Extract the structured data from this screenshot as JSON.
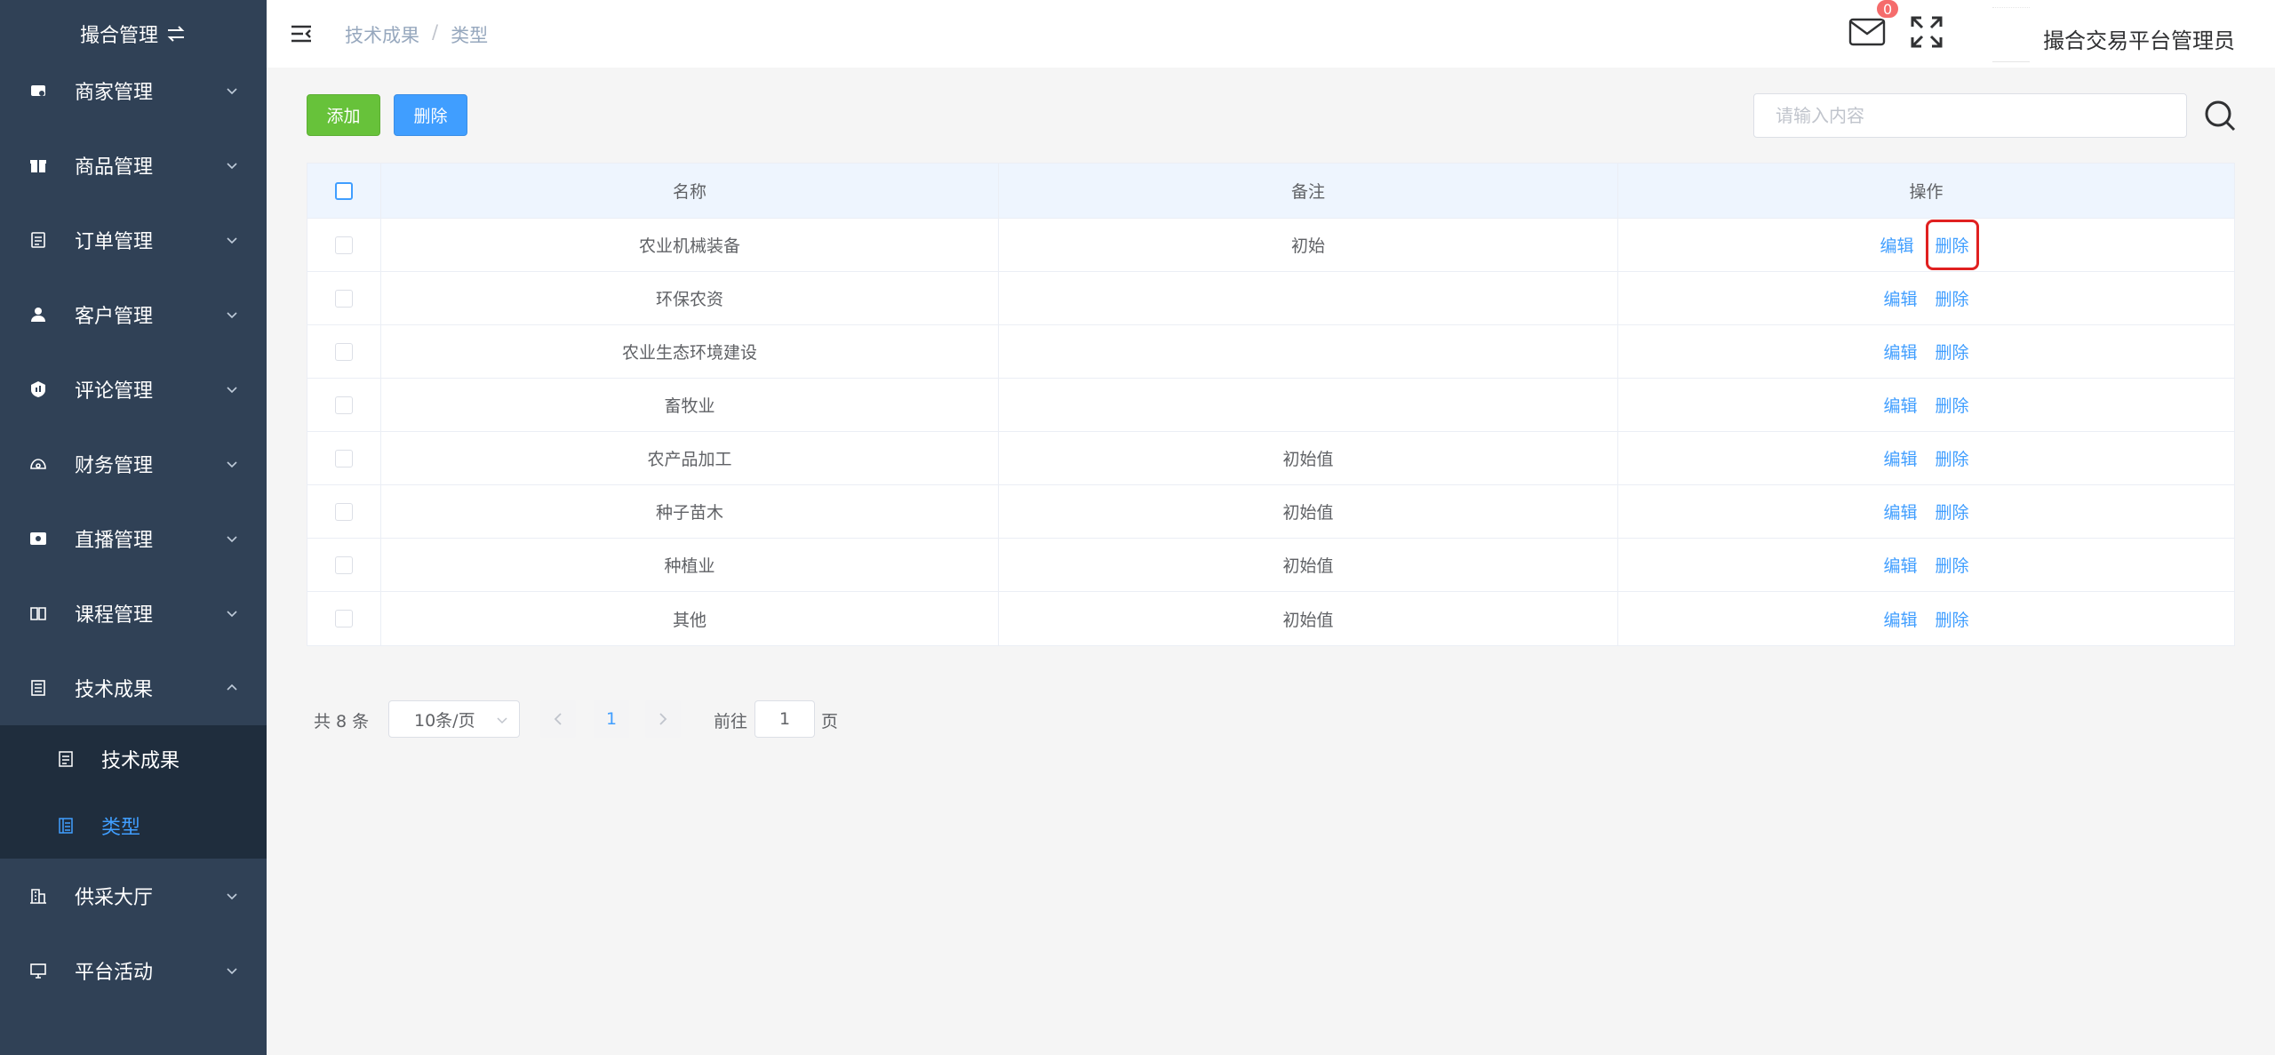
{
  "sidebar": {
    "title": "撮合管理",
    "items": [
      {
        "label": "商家管理",
        "icon": "store-icon"
      },
      {
        "label": "商品管理",
        "icon": "gift-icon"
      },
      {
        "label": "订单管理",
        "icon": "order-icon"
      },
      {
        "label": "客户管理",
        "icon": "user-icon"
      },
      {
        "label": "评论管理",
        "icon": "comment-icon"
      },
      {
        "label": "财务管理",
        "icon": "finance-icon"
      },
      {
        "label": "直播管理",
        "icon": "live-icon"
      },
      {
        "label": "课程管理",
        "icon": "book-icon"
      },
      {
        "label": "技术成果",
        "icon": "tech-icon"
      },
      {
        "label": "供采大厅",
        "icon": "building-icon"
      },
      {
        "label": "平台活动",
        "icon": "monitor-icon"
      }
    ],
    "subitems": [
      {
        "label": "技术成果",
        "active": false
      },
      {
        "label": "类型",
        "active": true
      }
    ]
  },
  "header": {
    "breadcrumb": [
      "技术成果",
      "类型"
    ],
    "mail_badge": "0",
    "username": "撮合交易平台管理员"
  },
  "toolbar": {
    "add_label": "添加",
    "delete_label": "删除",
    "search_placeholder": "请输入内容"
  },
  "table": {
    "columns": [
      "名称",
      "备注",
      "操作"
    ],
    "edit_label": "编辑",
    "delete_label": "删除",
    "rows": [
      {
        "name": "农业机械装备",
        "note": "初始"
      },
      {
        "name": "环保农资",
        "note": ""
      },
      {
        "name": "农业生态环境建设",
        "note": ""
      },
      {
        "name": "畜牧业",
        "note": ""
      },
      {
        "name": "农产品加工",
        "note": "初始值"
      },
      {
        "name": "种子苗木",
        "note": "初始值"
      },
      {
        "name": "种植业",
        "note": "初始值"
      },
      {
        "name": "其他",
        "note": "初始值"
      }
    ]
  },
  "pagination": {
    "total": "共 8 条",
    "page_size": "10条/页",
    "current_page": "1",
    "goto_label": "前往",
    "goto_value": "1",
    "goto_suffix": "页"
  },
  "colors": {
    "sidebar_bg": "#304156",
    "submenu_bg": "#1f2d3d",
    "primary": "#409eff",
    "success": "#67c23a",
    "danger": "#f56c6c",
    "highlight_box": "#e02020"
  }
}
